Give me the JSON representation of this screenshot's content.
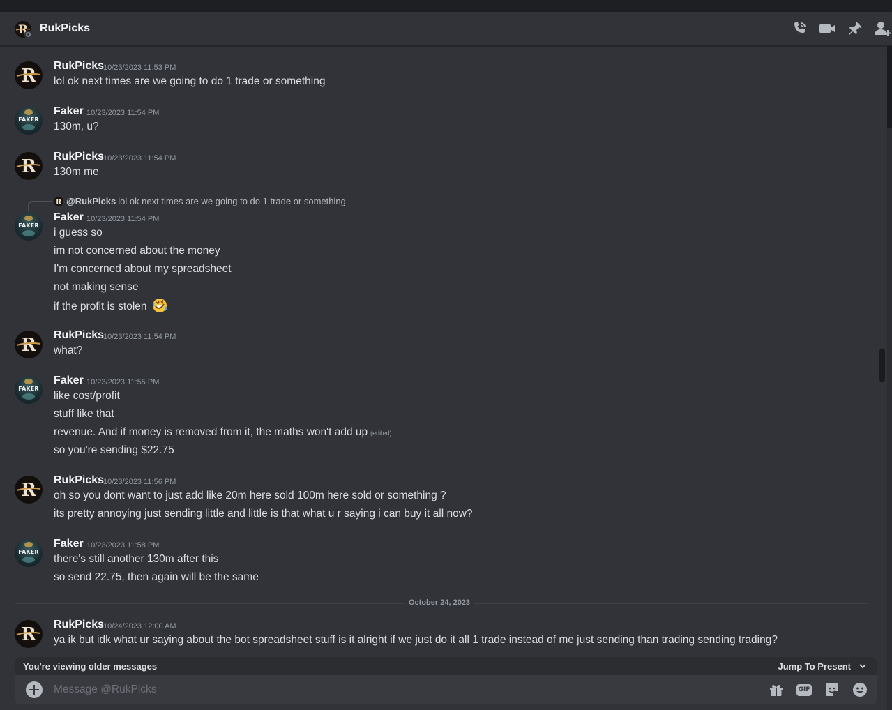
{
  "header": {
    "name": "RukPicks"
  },
  "messages": [
    {
      "author": "RukPicks",
      "timestamp": "10/23/2023 11:53 PM",
      "lines": [
        "lol ok next times are we going to do 1 trade or something"
      ]
    },
    {
      "author": "Faker",
      "timestamp": "10/23/2023 11:54 PM",
      "lines": [
        "130m, u?"
      ]
    },
    {
      "author": "RukPicks",
      "timestamp": "10/23/2023 11:54 PM",
      "lines": [
        "130m me"
      ]
    },
    {
      "author": "Faker",
      "timestamp": "10/23/2023 11:54 PM",
      "reply": {
        "name": "@RukPicks",
        "text": "lol ok next times are we going to do 1 trade or something"
      },
      "lines": [
        "i guess so",
        "im not concerned about the money",
        "I'm concerned about my spreadsheet",
        "not making sense",
        "if the profit is stolen"
      ]
    },
    {
      "author": "RukPicks",
      "timestamp": "10/23/2023 11:54 PM",
      "lines": [
        "what?"
      ]
    },
    {
      "author": "Faker",
      "timestamp": "10/23/2023 11:55 PM",
      "lines": [
        "like cost/profit",
        "stuff like that",
        "revenue. And if money is removed from it, the maths won't add up",
        "so you're sending $22.75"
      ],
      "edited_label": "(edited)"
    },
    {
      "author": "RukPicks",
      "timestamp": "10/23/2023 11:56 PM",
      "lines": [
        "oh so you dont want to just add like 20m here sold 100m here sold or something ?",
        "its pretty annoying just sending little and little is that what u r saying i can buy it all now?"
      ]
    },
    {
      "author": "Faker",
      "timestamp": "10/23/2023 11:58 PM",
      "lines": [
        "there's still another 130m after this",
        "so send 22.75, then again will be the same"
      ]
    },
    {
      "author": "RukPicks",
      "timestamp": "10/24/2023 12:00 AM",
      "lines": [
        "ya ik but idk what ur saying about the bot spreadsheet stuff is it alright if we just do it all 1 trade instead of me just sending than trading sending trading?"
      ]
    }
  ],
  "avatar_text": {
    "faker": "FAKER"
  },
  "divider": {
    "label": "October 24, 2023"
  },
  "older_bar": {
    "text": "You're viewing older messages",
    "jump": "Jump To Present"
  },
  "composer": {
    "placeholder": "Message @RukPicks",
    "gif_label": "GIF"
  },
  "icons": {
    "header": [
      "phone-call-icon",
      "video-call-icon",
      "pin-icon",
      "add-friend-icon"
    ],
    "composer": [
      "plus-icon",
      "gift-icon",
      "gif-icon",
      "sticker-icon",
      "emoji-icon"
    ]
  },
  "colors": {
    "background": "#313338",
    "accent": "#5865f2",
    "muted": "#949ba4"
  }
}
